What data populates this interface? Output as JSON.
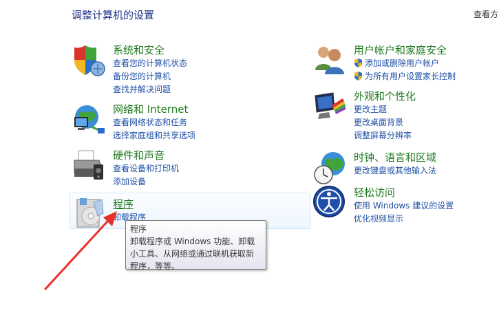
{
  "header": {
    "title": "调整计算机的设置",
    "view_by": "查看方式"
  },
  "categories": {
    "system": {
      "title": "系统和安全",
      "links": [
        "查看您的计算机状态",
        "备份您的计算机",
        "查找并解决问题"
      ]
    },
    "network": {
      "title": "网络和 Internet",
      "links": [
        "查看网络状态和任务",
        "选择家庭组和共享选项"
      ]
    },
    "hardware": {
      "title": "硬件和声音",
      "links": [
        "查看设备和打印机",
        "添加设备"
      ]
    },
    "programs": {
      "title": "程序",
      "links": [
        "卸载程序"
      ]
    },
    "users": {
      "title": "用户帐户和家庭安全",
      "links": [
        "添加或删除用户帐户",
        "为所有用户设置家长控制"
      ]
    },
    "appearance": {
      "title": "外观和个性化",
      "links": [
        "更改主题",
        "更改桌面背景",
        "调整屏幕分辨率"
      ]
    },
    "clock": {
      "title": "时钟、语言和区域",
      "links": [
        "更改键盘或其他输入法"
      ]
    },
    "ease": {
      "title": "轻松访问",
      "links": [
        "使用 Windows 建议的设置",
        "优化视频显示"
      ]
    }
  },
  "tooltip": {
    "title": "程序",
    "body": "卸载程序或 Windows 功能、卸载小工具、从网络或通过联机获取新程序，等等。"
  },
  "colors": {
    "title_green": "#1f7a1f",
    "link_blue": "#1e4fa5",
    "heading_blue": "#1e3287",
    "annotation_red": "#e8302a"
  }
}
